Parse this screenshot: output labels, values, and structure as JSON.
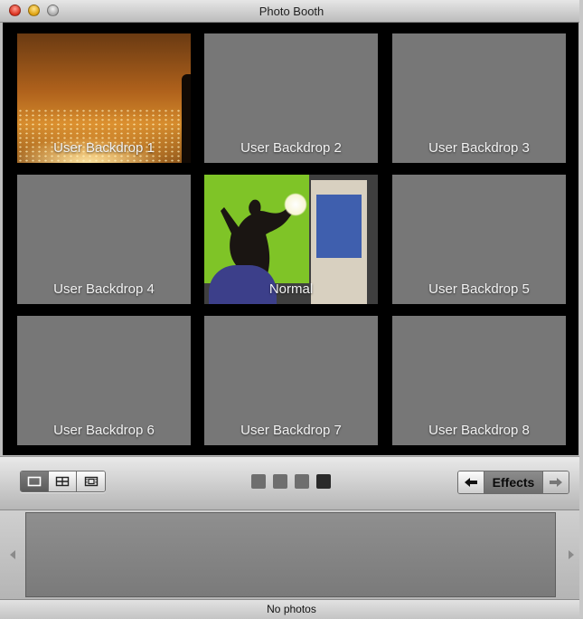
{
  "window": {
    "title": "Photo Booth"
  },
  "grid": {
    "tiles": [
      {
        "label": "User Backdrop 1",
        "thumbnail": "city-lights"
      },
      {
        "label": "User Backdrop 2"
      },
      {
        "label": "User Backdrop 3"
      },
      {
        "label": "User Backdrop 4"
      },
      {
        "label": "Normal",
        "thumbnail": "live-camera",
        "selected": true
      },
      {
        "label": "User Backdrop 5"
      },
      {
        "label": "User Backdrop 6"
      },
      {
        "label": "User Backdrop 7"
      },
      {
        "label": "User Backdrop 8"
      }
    ]
  },
  "toolbar": {
    "view_modes": [
      {
        "icon": "single-photo-icon",
        "active": true
      },
      {
        "icon": "four-up-icon",
        "active": false
      },
      {
        "icon": "movie-icon",
        "active": false
      }
    ],
    "pages": {
      "count": 4,
      "current": 4
    },
    "effects_label": "Effects"
  },
  "status": {
    "text": "No photos"
  },
  "colors": {
    "accent": "#6e6e6e",
    "stage_bg": "#000000",
    "tile_bg": "#777777"
  }
}
